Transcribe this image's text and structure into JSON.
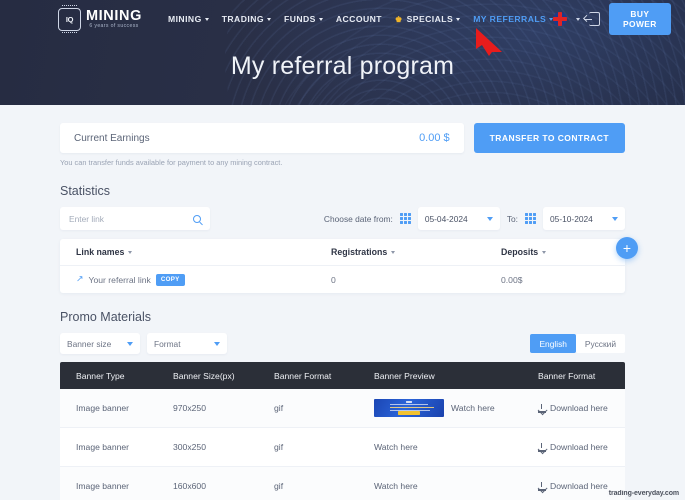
{
  "header": {
    "logo": {
      "mark": "IQ",
      "name": "MINING",
      "tagline": "6 years of success"
    },
    "nav": [
      {
        "label": "MINING",
        "has_caret": true,
        "active": false,
        "star": false
      },
      {
        "label": "TRADING",
        "has_caret": true,
        "active": false,
        "star": false
      },
      {
        "label": "FUNDS",
        "has_caret": true,
        "active": false,
        "star": false
      },
      {
        "label": "ACCOUNT",
        "has_caret": false,
        "active": false,
        "star": false
      },
      {
        "label": "SPECIALS",
        "has_caret": true,
        "active": false,
        "star": true
      },
      {
        "label": "MY REFERRALS",
        "has_caret": true,
        "active": true,
        "star": false
      }
    ],
    "language_flag": "uk-flag-icon",
    "login_icon": "login-icon",
    "buy_power_label": "BUY POWER",
    "accent_color": "#4f9df5",
    "active_nav_color": "#4f9df5"
  },
  "hero": {
    "title": "My referral program"
  },
  "earnings": {
    "label": "Current Earnings",
    "value": "0.00 $",
    "transfer_label": "TRANSFER TO CONTRACT",
    "note": "You can transfer funds available for payment to any mining contract."
  },
  "statistics": {
    "title": "Statistics",
    "search_placeholder": "Enter link",
    "search_value": "",
    "date_from_label": "Choose date from:",
    "date_from": "05-04-2024",
    "date_to_label": "To:",
    "date_to": "05-10-2024",
    "columns": [
      "Link names",
      "Registrations",
      "Deposits"
    ],
    "rows": [
      {
        "link_name": "Your referral link",
        "copy_label": "COPY",
        "registrations": "0",
        "deposits": "0.00$"
      }
    ],
    "add_button_label": "+"
  },
  "promo": {
    "title": "Promo Materials",
    "banner_size_label": "Banner size",
    "format_label": "Format",
    "languages": [
      {
        "label": "English",
        "active": true
      },
      {
        "label": "Русский",
        "active": false
      }
    ],
    "columns": [
      "Banner Type",
      "Banner Size(px)",
      "Banner Format",
      "Banner Preview",
      "Banner Format"
    ],
    "rows": [
      {
        "type": "Image banner",
        "size": "970x250",
        "format": "gif",
        "has_preview": true,
        "watch": "Watch here",
        "download": "Download here"
      },
      {
        "type": "Image banner",
        "size": "300x250",
        "format": "gif",
        "has_preview": false,
        "watch": "Watch here",
        "download": "Download here"
      },
      {
        "type": "Image banner",
        "size": "160x600",
        "format": "gif",
        "has_preview": false,
        "watch": "Watch here",
        "download": "Download here"
      }
    ]
  },
  "watermark": {
    "text": "trading-everyday.com"
  }
}
